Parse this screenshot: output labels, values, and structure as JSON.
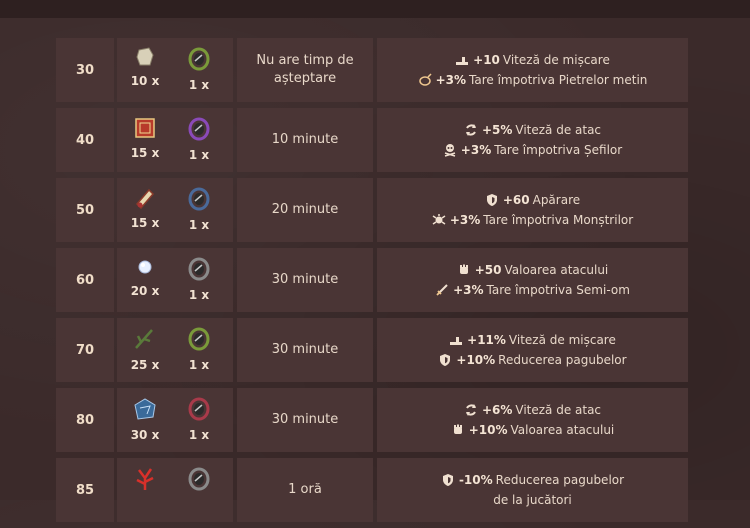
{
  "rows": [
    {
      "level": "30",
      "item1": {
        "icon": "stone-icon",
        "qty": "10 x"
      },
      "item2": {
        "icon": "green-ring-icon",
        "qty": "1 x"
      },
      "time": "Nu are timp de așteptare",
      "bonuses": [
        {
          "icon": "boots-icon",
          "value": "+10",
          "text": "Viteză de mișcare"
        },
        {
          "icon": "metin-icon",
          "value": "+3%",
          "text": "Tare împotriva Pietrelor metin"
        }
      ]
    },
    {
      "level": "40",
      "item1": {
        "icon": "red-book-icon",
        "qty": "15 x"
      },
      "item2": {
        "icon": "purple-ring-icon",
        "qty": "1 x"
      },
      "time": "10 minute",
      "bonuses": [
        {
          "icon": "attack-speed-icon",
          "value": "+5%",
          "text": "Viteză de atac"
        },
        {
          "icon": "skull-icon",
          "value": "+3%",
          "text": "Tare împotriva Șefilor"
        }
      ]
    },
    {
      "level": "50",
      "item1": {
        "icon": "scroll-icon",
        "qty": "15 x"
      },
      "item2": {
        "icon": "blue-ring-icon",
        "qty": "1 x"
      },
      "time": "20 minute",
      "bonuses": [
        {
          "icon": "shield-icon",
          "value": "+60",
          "text": "Apărare"
        },
        {
          "icon": "monster-icon",
          "value": "+3%",
          "text": "Tare împotriva Monștrilor"
        }
      ]
    },
    {
      "level": "60",
      "item1": {
        "icon": "diamond-icon",
        "qty": "20 x"
      },
      "item2": {
        "icon": "grey-ring-icon",
        "qty": "1 x"
      },
      "time": "30 minute",
      "bonuses": [
        {
          "icon": "fist-icon",
          "value": "+50",
          "text": "Valoarea atacului"
        },
        {
          "icon": "sword-icon",
          "value": "+3%",
          "text": "Tare împotriva Semi-om"
        }
      ]
    },
    {
      "level": "70",
      "item1": {
        "icon": "branch-icon",
        "qty": "25 x"
      },
      "item2": {
        "icon": "green-ring-icon",
        "qty": "1 x"
      },
      "time": "30 minute",
      "bonuses": [
        {
          "icon": "boots-icon",
          "value": "+11%",
          "text": "Viteză de mișcare"
        },
        {
          "icon": "shield-icon",
          "value": "+10%",
          "text": "Reducerea pagubelor"
        }
      ]
    },
    {
      "level": "80",
      "item1": {
        "icon": "blue-crystal-icon",
        "qty": "30 x"
      },
      "item2": {
        "icon": "red-ring-icon",
        "qty": "1 x"
      },
      "time": "30 minute",
      "bonuses": [
        {
          "icon": "attack-speed-icon",
          "value": "+6%",
          "text": "Viteză de atac"
        },
        {
          "icon": "fist-icon",
          "value": "+10%",
          "text": "Valoarea atacului"
        }
      ]
    },
    {
      "level": "85",
      "item1": {
        "icon": "red-coral-icon",
        "qty": ""
      },
      "item2": {
        "icon": "grey-ring-icon",
        "qty": ""
      },
      "time": "1 oră",
      "bonuses": [
        {
          "icon": "shield-icon",
          "value": "-10%",
          "text": "Reducerea pagubelor"
        },
        {
          "icon": "",
          "value": "",
          "text": "de la jucători"
        }
      ]
    }
  ],
  "colors": {
    "accent": "#f0ddc8",
    "cell": "#4a3535",
    "background": "#3b2a2a"
  }
}
